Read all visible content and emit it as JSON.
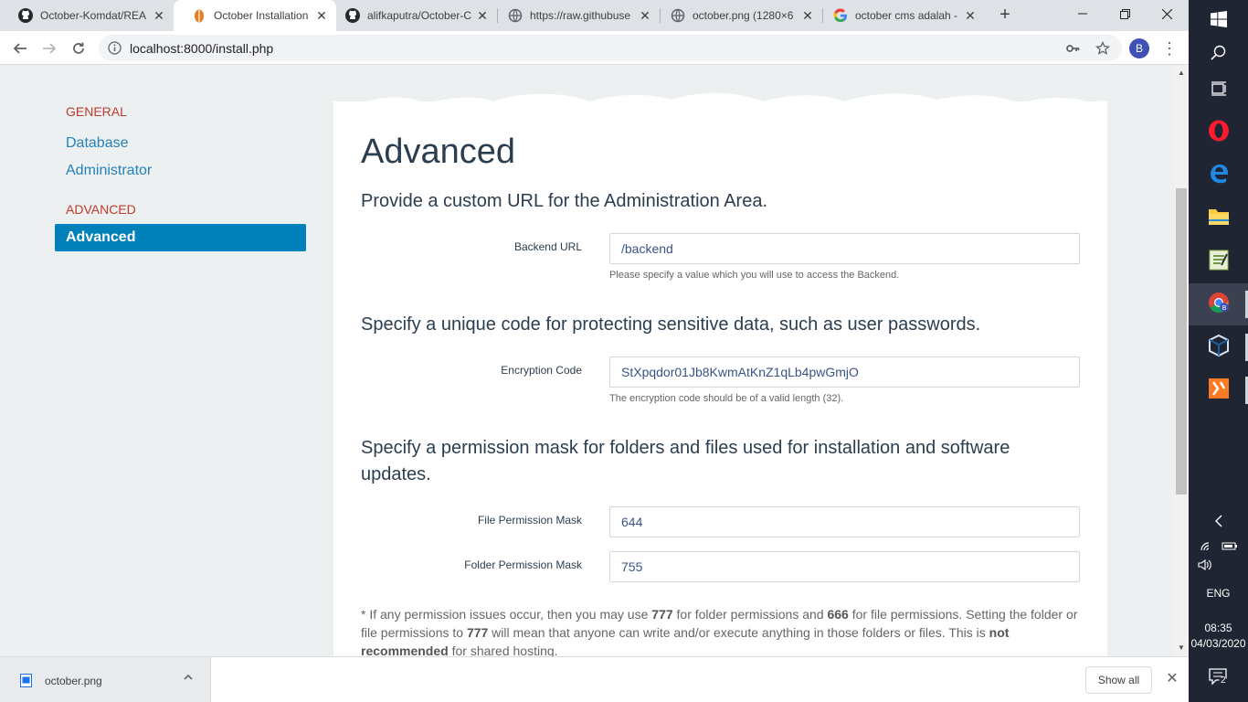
{
  "tabs": [
    {
      "title": "October-Komdat/REA",
      "icon": "github-icon"
    },
    {
      "title": "October Installation",
      "icon": "october-icon",
      "active": true
    },
    {
      "title": "alifkaputra/October-C",
      "icon": "github-icon"
    },
    {
      "title": "https://raw.githubuse",
      "icon": "globe-icon"
    },
    {
      "title": "october.png (1280×6",
      "icon": "globe-icon"
    },
    {
      "title": "october cms adalah -",
      "icon": "google-icon"
    }
  ],
  "address": {
    "url": "localhost:8000/install.php"
  },
  "profile": {
    "initial": "B"
  },
  "sidebar": {
    "general_heading": "GENERAL",
    "general_items": [
      "Database",
      "Administrator"
    ],
    "advanced_heading": "ADVANCED",
    "advanced_active": "Advanced"
  },
  "content": {
    "title": "Advanced",
    "url_section": {
      "heading": "Provide a custom URL for the Administration Area.",
      "label": "Backend URL",
      "value": "/backend",
      "help": "Please specify a value which you will use to access the Backend."
    },
    "encryption_section": {
      "heading": "Specify a unique code for protecting sensitive data, such as user passwords.",
      "label": "Encryption Code",
      "value": "StXpqdor01Jb8KwmAtKnZ1qLb4pwGmjO",
      "help": "The encryption code should be of a valid length (32)."
    },
    "permission_section": {
      "heading": "Specify a permission mask for folders and files used for installation and software updates.",
      "file_label": "File Permission Mask",
      "file_value": "644",
      "folder_label": "Folder Permission Mask",
      "folder_value": "755"
    },
    "note": {
      "p1": "* If any permission issues occur, then you may use ",
      "b1": "777",
      "p2": " for folder permissions and ",
      "b2": "666",
      "p3": " for file permissions. Setting the folder or file permissions to ",
      "b3": "777",
      "p4": " will mean that anyone can write and/or execute anything in those folders or files. This is ",
      "b4": "not recommended",
      "p5": " for shared hosting."
    }
  },
  "downloads": {
    "file": "october.png",
    "show_all": "Show all"
  },
  "taskbar": {
    "language": "ENG",
    "time": "08:35",
    "date": "04/03/2020",
    "notifications": "2"
  },
  "colors": {
    "accent": "#0181b9",
    "heading_red": "#c0392b",
    "link": "#2581b8",
    "text": "#2b3e50",
    "page_bg": "#ecf0f1"
  }
}
